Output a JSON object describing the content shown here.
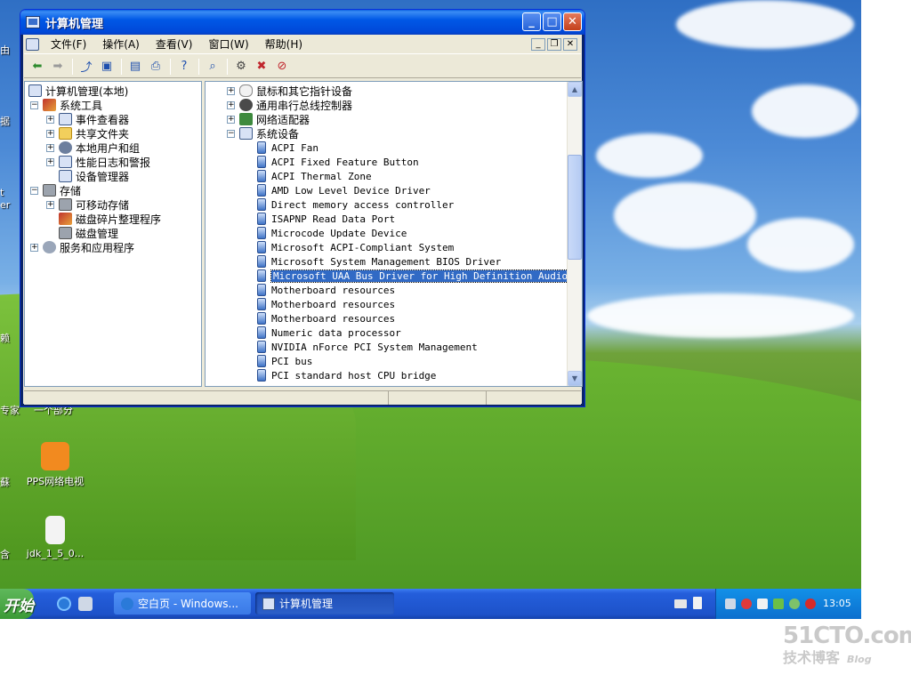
{
  "window": {
    "title": "计算机管理",
    "menu": [
      "文件(F)",
      "操作(A)",
      "查看(V)",
      "窗口(W)",
      "帮助(H)"
    ]
  },
  "tree": {
    "root": "计算机管理(本地)",
    "system_tools": "系统工具",
    "event_viewer": "事件查看器",
    "shared_folders": "共享文件夹",
    "local_users": "本地用户和组",
    "perf_logs": "性能日志和警报",
    "device_manager": "设备管理器",
    "storage": "存储",
    "removable_storage": "可移动存储",
    "defrag": "磁盘碎片整理程序",
    "disk_management": "磁盘管理",
    "services_apps": "服务和应用程序"
  },
  "devices": {
    "categories": [
      "鼠标和其它指针设备",
      "通用串行总线控制器",
      "网络适配器",
      "系统设备"
    ],
    "items": [
      "ACPI Fan",
      "ACPI Fixed Feature Button",
      "ACPI Thermal Zone",
      "AMD Low Level Device Driver",
      "Direct memory access controller",
      "ISAPNP Read Data Port",
      "Microcode Update Device",
      "Microsoft ACPI-Compliant System",
      "Microsoft System Management BIOS Driver",
      "Microsoft UAA Bus Driver for High Definition Audio",
      "Motherboard resources",
      "Motherboard resources",
      "Motherboard resources",
      "Numeric data processor",
      "NVIDIA nForce PCI System Management",
      "PCI bus",
      "PCI standard host CPU bridge"
    ],
    "selected_index": 9
  },
  "desktop": {
    "icons": [
      "PPS网络电视",
      "jdk_1_5_0..."
    ],
    "edge_labels": [
      "由",
      "据",
      "t",
      "er",
      "赖",
      "专家",
      "蘇",
      "含"
    ],
    "partial_label": "一个部分"
  },
  "taskbar": {
    "start": "开始",
    "tasks": [
      "空白页 - Windows...",
      "计算机管理"
    ],
    "clock": "13:05"
  },
  "watermark": {
    "main": "51CTO.com",
    "sub": "技术博客",
    "blog": "Blog"
  }
}
